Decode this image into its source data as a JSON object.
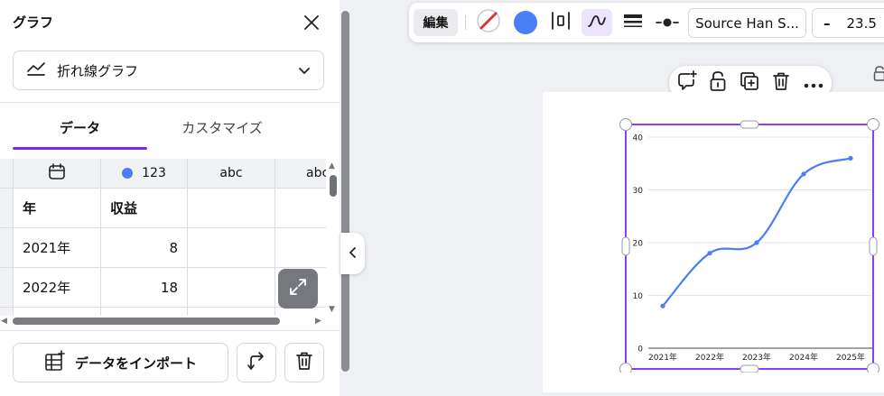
{
  "panel": {
    "title": "グラフ",
    "chart_type": "折れ線グラフ",
    "tabs": [
      "データ",
      "カスタマイズ"
    ],
    "grid": {
      "type_row": {
        "col2": "123",
        "col3": "abc",
        "col4": "abc"
      },
      "headers": [
        "年",
        "収益"
      ],
      "rows": [
        {
          "year": "2021年",
          "value": "8"
        },
        {
          "year": "2022年",
          "value": "18"
        }
      ]
    },
    "import_label": "データをインポート"
  },
  "toolbar": {
    "edit_label": "編集",
    "color": "#4a7ef7",
    "font": "Source Han S...",
    "minus": "–",
    "font_size": "23.5"
  },
  "icons": {
    "close": "close-icon",
    "line_chart": "line-chart-icon",
    "calendar": "calendar-icon",
    "expand": "expand-icon",
    "table_add": "table-add-icon",
    "swap": "swap-axes-icon",
    "trash": "trash-icon",
    "comment": "comment-add-icon",
    "lock": "lock-icon",
    "duplicate": "duplicate-icon",
    "more": "more-icon"
  },
  "chart_data": {
    "type": "line",
    "categories": [
      "2021年",
      "2022年",
      "2023年",
      "2024年",
      "2025年"
    ],
    "series": [
      {
        "values": [
          8,
          18,
          20,
          33,
          36
        ],
        "color": "#4a7ef7"
      }
    ],
    "ylim": [
      0,
      40
    ],
    "yticks": [
      0,
      10,
      20,
      30,
      40
    ],
    "grid": true,
    "smooth": true
  }
}
